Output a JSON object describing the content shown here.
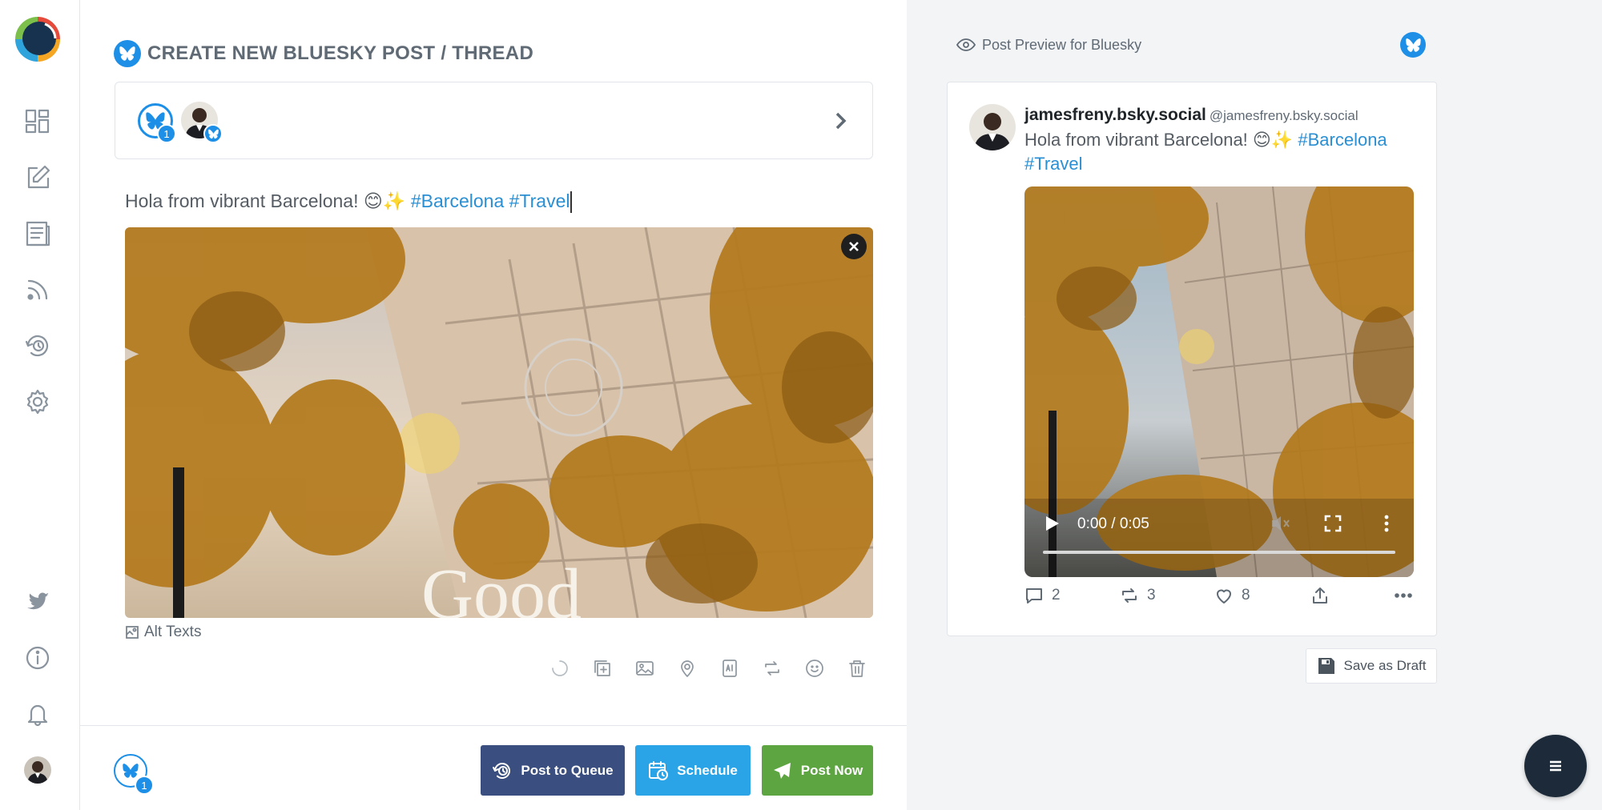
{
  "app": {
    "title": "CREATE NEW BLUESKY POST / THREAD",
    "brand_colors": {
      "bluesky": "#1d8fe6",
      "queue": "#3a4f7f",
      "schedule": "#2aa4e6",
      "post_now": "#5da540",
      "hashtag": "#2a8fd3"
    }
  },
  "sidebar": {
    "logo": "app-logo",
    "items": [
      {
        "icon": "dashboard-icon"
      },
      {
        "icon": "compose-icon"
      },
      {
        "icon": "posts-list-icon"
      },
      {
        "icon": "rss-feed-icon"
      },
      {
        "icon": "queue-clock-icon"
      },
      {
        "icon": "settings-gear-icon"
      }
    ],
    "bottom_items": [
      {
        "icon": "twitter-bird-icon"
      },
      {
        "icon": "info-icon"
      },
      {
        "icon": "bell-icon"
      },
      {
        "icon": "user-avatar"
      }
    ]
  },
  "composer": {
    "account_count": "1",
    "post_text": "Hola from vibrant Barcelona! 😊✨",
    "hashtags": [
      "#Barcelona",
      "#Travel"
    ],
    "alt_texts_label": "Alt Texts",
    "tools": [
      "loading-spinner-icon",
      "add-media-icon",
      "image-icon",
      "location-pin-icon",
      "ai-assist-icon",
      "repost-icon",
      "emoji-icon",
      "trash-icon"
    ]
  },
  "footer": {
    "account_count": "1",
    "post_to_queue_label": "Post to Queue",
    "schedule_label": "Schedule",
    "post_now_label": "Post Now"
  },
  "preview": {
    "header_label": "Post Preview for Bluesky",
    "display_name": "jamesfreny.bsky.social",
    "handle": "@jamesfreny.bsky.social",
    "text": "Hola from vibrant Barcelona! 😊✨",
    "hashtags": [
      "#Barcelona",
      "#Travel"
    ],
    "video_time": "0:00 / 0:05",
    "replies": "2",
    "reposts": "3",
    "likes": "8",
    "save_draft_label": "Save as Draft"
  }
}
